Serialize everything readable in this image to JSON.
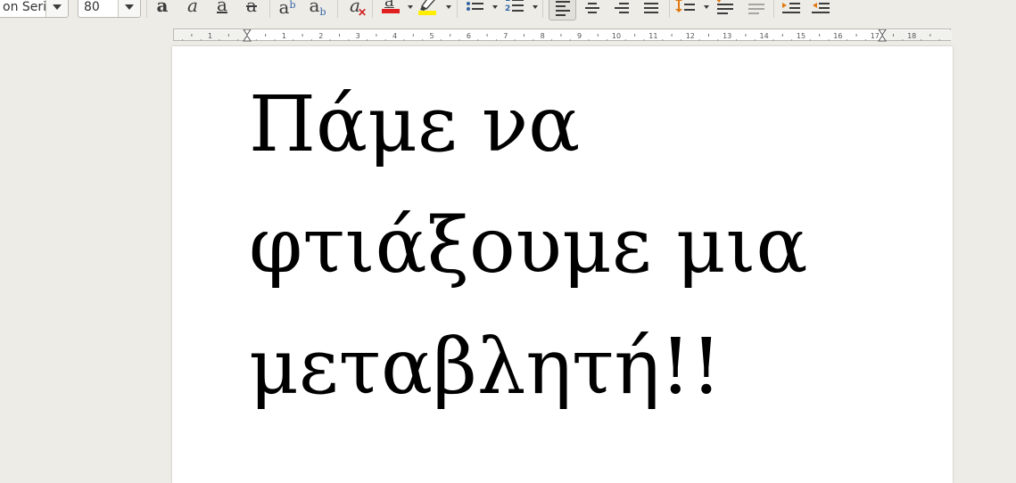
{
  "toolbar": {
    "font_name_value": "on Serif",
    "font_size_value": "80",
    "buttons": {
      "bold": "a",
      "italic": "a",
      "underline": "a",
      "strikethrough": "a",
      "superscript_base": "a",
      "superscript_mark": "b",
      "subscript_base": "a",
      "subscript_mark": "b",
      "clear_formatting": "a",
      "font_color": "a"
    },
    "icons": [
      "bold-icon",
      "italic-icon",
      "underline-icon",
      "strikethrough-icon",
      "superscript-icon",
      "subscript-icon",
      "clear-formatting-icon",
      "font-color-icon",
      "highlight-icon",
      "bullet-list-icon",
      "numbered-list-icon",
      "align-left-icon",
      "align-center-icon",
      "align-right-icon",
      "justify-icon",
      "line-spacing-icon",
      "increase-paragraph-spacing-icon",
      "decrease-paragraph-spacing-icon",
      "increase-indent-icon",
      "decrease-indent-icon"
    ],
    "numbered_list_marks": [
      "1",
      "2"
    ],
    "colors": {
      "font_color_bar": "#e02020",
      "highlight_bar": "#ffee00",
      "active_button_bg": "#e1e0da"
    }
  },
  "ruler": {
    "labels": [
      "1",
      "1",
      "2",
      "3",
      "4",
      "5",
      "6",
      "7",
      "8",
      "9",
      "10",
      "11",
      "12",
      "13",
      "14",
      "15",
      "16",
      "17",
      "18"
    ]
  },
  "document": {
    "lines": [
      "Πάμε να",
      "φτιάξουμε μια",
      "μεταβλητή!!"
    ]
  }
}
